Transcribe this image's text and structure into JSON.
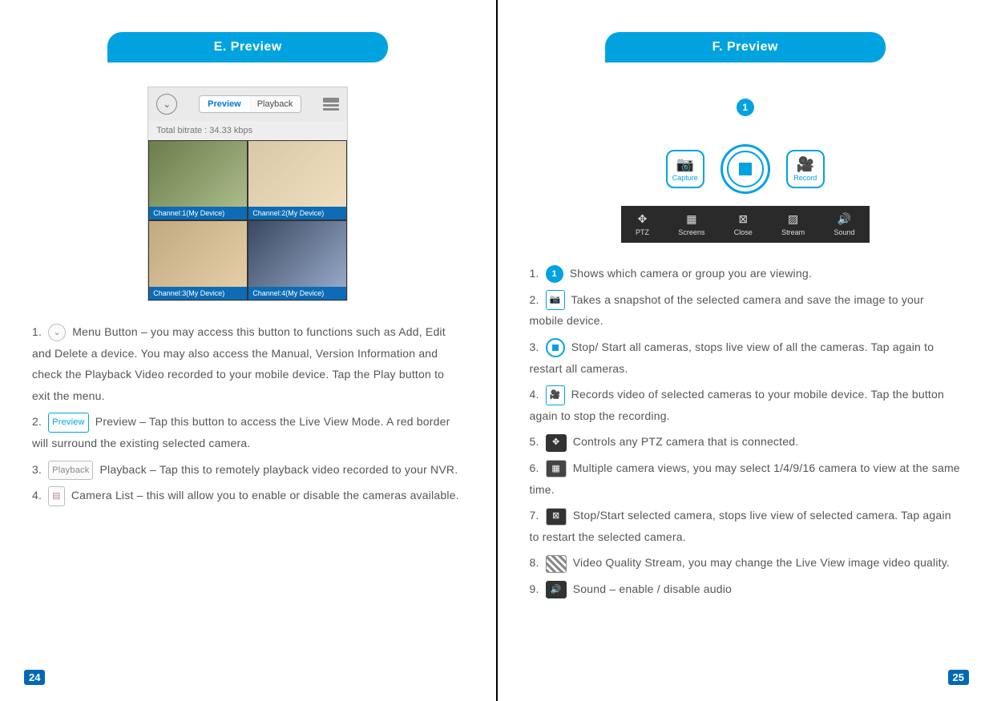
{
  "left": {
    "title": "E. Preview",
    "app": {
      "seg_preview": "Preview",
      "seg_playback": "Playback",
      "bitrate": "Total bitrate : 34.33 kbps",
      "channels": [
        "Channel:1(My Device)",
        "Channel:2(My Device)",
        "Channel:3(My Device)",
        "Channel:4(My Device)"
      ]
    },
    "items": {
      "n1": "1.",
      "t1": "Menu Button – you may access this button to functions such as Add, Edit and Delete a device. You may also access the Manual, Version Information and check the Playback Video recorded to your mobile device. Tap the Play button to exit the menu.",
      "n2": "2.",
      "btn2": "Preview",
      "t2": "Preview – Tap this button to access the Live View Mode. A red border will surround the existing selected camera.",
      "n3": "3.",
      "btn3": "Playback",
      "t3": "Playback – Tap this to remotely playback video recorded to your NVR.",
      "n4": "4.",
      "t4": "Camera List – this will allow you to enable or disable the cameras available."
    },
    "page_number": "24"
  },
  "right": {
    "title": "F. Preview",
    "indicator": "1",
    "btn_capture": "Capture",
    "btn_record": "Record",
    "toolbar": {
      "ptz": "PTZ",
      "screens": "Screens",
      "close": "Close",
      "stream": "Stream",
      "sound": "Sound"
    },
    "items": {
      "n1": "1.",
      "t1": "Shows which camera or group you are viewing.",
      "n2": "2.",
      "t2": "Takes a snapshot of the selected camera and save the image to your mobile device.",
      "n3": "3.",
      "t3": "Stop/ Start all cameras, stops live view of all the cameras. Tap again to restart all cameras.",
      "n4": "4.",
      "t4": "Records video of selected cameras to your mobile device. Tap the button again to stop the recording.",
      "n5": "5.",
      "t5": "Controls any PTZ camera that is connected.",
      "n6": "6.",
      "t6": "Multiple camera views, you may select 1/4/9/16 camera to view at the same time.",
      "n7": "7.",
      "t7": "Stop/Start selected camera, stops live view of selected camera. Tap again to restart the selected camera.",
      "n8": "8.",
      "t8": "Video Quality Stream, you may change the Live View image video quality.",
      "n9": "9.",
      "t9": "Sound – enable / disable audio"
    },
    "page_number": "25"
  }
}
